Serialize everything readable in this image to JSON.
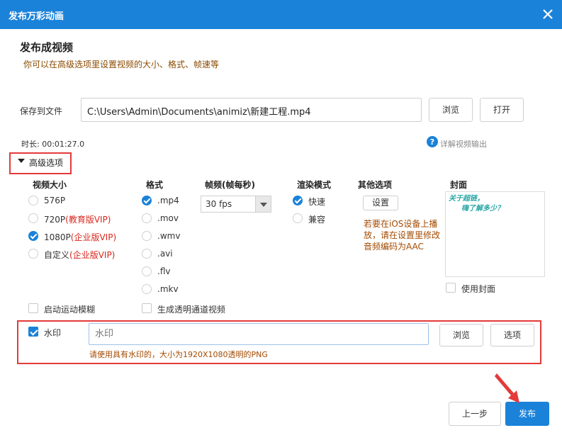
{
  "window": {
    "title": "发布万彩动画"
  },
  "header": {
    "title": "发布成视频",
    "subtitle": "你可以在高级选项里设置视频的大小、格式、帧速等"
  },
  "file": {
    "label": "保存到文件",
    "path": "C:\\Users\\Admin\\Documents\\animiz\\新建工程.mp4",
    "browse": "浏览",
    "open": "打开"
  },
  "duration": {
    "text": "时长: 00:01:27.0"
  },
  "help_link": "详解视频输出",
  "advanced": {
    "label": "高级选项"
  },
  "video_size": {
    "header": "视频大小",
    "options": [
      {
        "label": "576P",
        "vip": "",
        "selected": false
      },
      {
        "label": "720P",
        "vip": "(教育版VIP)",
        "selected": false
      },
      {
        "label": "1080P",
        "vip": "(企业版VIP)",
        "selected": true
      },
      {
        "label": "自定义",
        "vip": "(企业版VIP)",
        "selected": false
      }
    ]
  },
  "format": {
    "header": "格式",
    "options": [
      ".mp4",
      ".mov",
      ".wmv",
      ".avi",
      ".flv",
      ".mkv"
    ],
    "selected": ".mp4"
  },
  "frame_rate": {
    "header": "帧频(帧每秒)",
    "value": "30 fps"
  },
  "render_mode": {
    "header": "渲染模式",
    "options": [
      "快速",
      "兼容"
    ],
    "selected": "快速"
  },
  "other": {
    "header": "其他选项",
    "settings_button": "设置",
    "note": "若要在iOS设备上播放，请在设置里修改音频编码为AAC"
  },
  "cover": {
    "header": "封面",
    "preview_line1": "关于超链，",
    "preview_line2": "嗨了解多少？",
    "use_cover_label": "使用封面"
  },
  "motion_blur": {
    "label": "启动运动模糊",
    "checked": false
  },
  "alpha_video": {
    "label": "生成透明通道视频",
    "checked": false
  },
  "watermark": {
    "label": "水印",
    "checked": true,
    "placeholder": "水印",
    "browse": "浏览",
    "options": "选项",
    "hint": "请使用具有水印的，大小为1920X1080透明的PNG"
  },
  "footer": {
    "back": "上一步",
    "publish": "发布"
  },
  "colors": {
    "accent": "#1a82d9",
    "highlight": "#e43a3a",
    "vip": "#d9251c",
    "note": "#a34a00"
  }
}
